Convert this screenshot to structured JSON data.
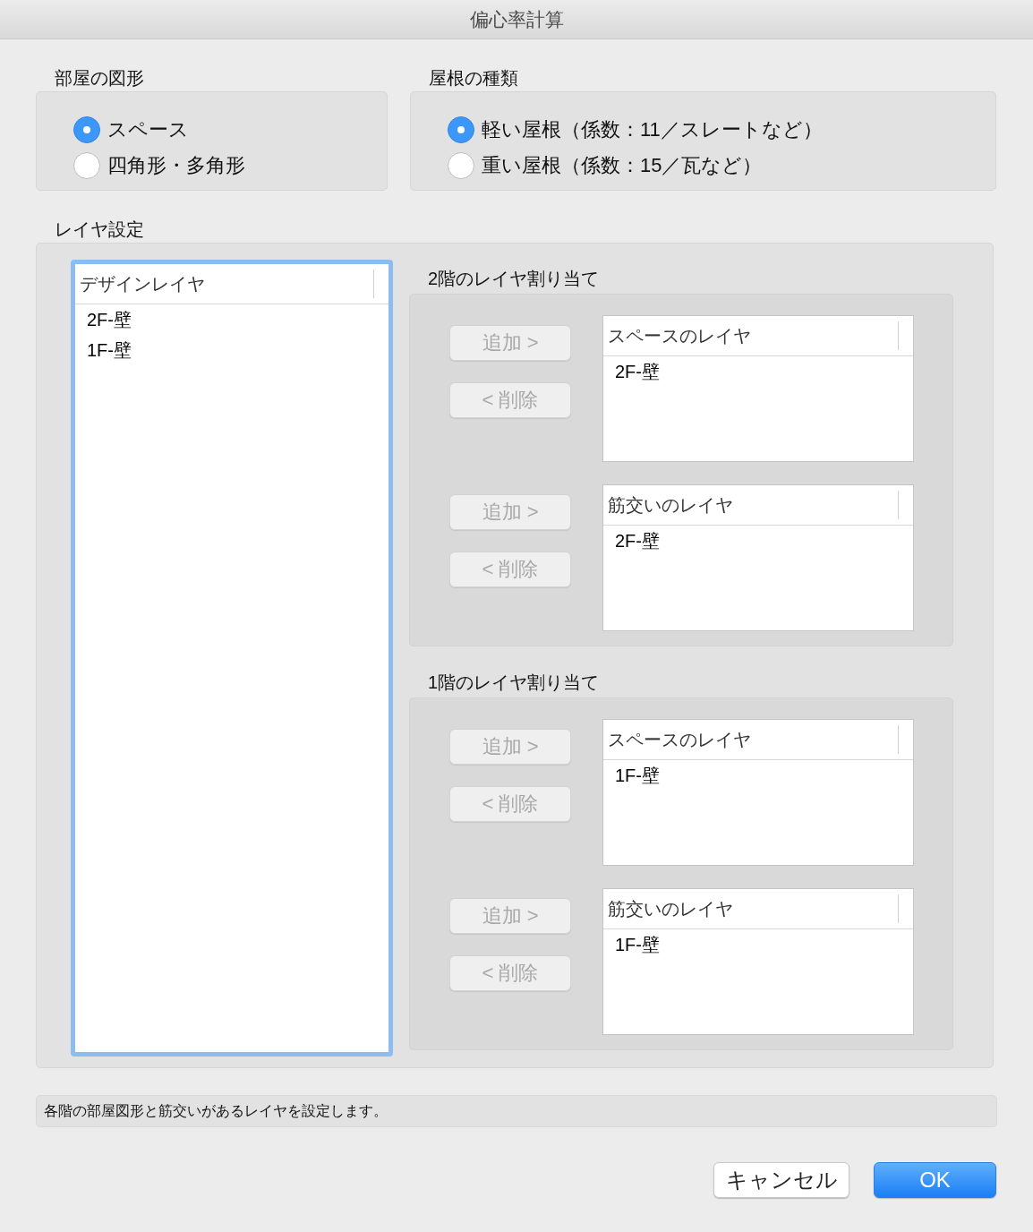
{
  "window": {
    "title": "偏心率計算"
  },
  "room_shape": {
    "label": "部屋の図形",
    "options": [
      {
        "label": "スペース",
        "selected": true
      },
      {
        "label": "四角形・多角形",
        "selected": false
      }
    ]
  },
  "roof_type": {
    "label": "屋根の種類",
    "options": [
      {
        "label": "軽い屋根（係数：11／スレートなど）",
        "selected": true
      },
      {
        "label": "重い屋根（係数：15／瓦など）",
        "selected": false
      }
    ]
  },
  "layer_settings": {
    "label": "レイヤ設定",
    "design_layers": {
      "header": "デザインレイヤ",
      "focused": true,
      "items": [
        "2F-壁",
        "1F-壁"
      ]
    },
    "floors": [
      {
        "label": "2階のレイヤ割り当て",
        "assignments": [
          {
            "add_button": {
              "label": "追加 >",
              "disabled": true
            },
            "remove_button": {
              "label": "< 削除",
              "disabled": true
            },
            "list": {
              "header": "スペースのレイヤ",
              "items": [
                "2F-壁"
              ]
            }
          },
          {
            "add_button": {
              "label": "追加 >",
              "disabled": true
            },
            "remove_button": {
              "label": "< 削除",
              "disabled": true
            },
            "list": {
              "header": "筋交いのレイヤ",
              "items": [
                "2F-壁"
              ]
            }
          }
        ]
      },
      {
        "label": "1階のレイヤ割り当て",
        "assignments": [
          {
            "add_button": {
              "label": "追加 >",
              "disabled": true
            },
            "remove_button": {
              "label": "< 削除",
              "disabled": true
            },
            "list": {
              "header": "スペースのレイヤ",
              "items": [
                "1F-壁"
              ]
            }
          },
          {
            "add_button": {
              "label": "追加 >",
              "disabled": true
            },
            "remove_button": {
              "label": "< 削除",
              "disabled": true
            },
            "list": {
              "header": "筋交いのレイヤ",
              "items": [
                "1F-壁"
              ]
            }
          }
        ]
      }
    ]
  },
  "status_text": "各階の部屋図形と筋交いがあるレイヤを設定します。",
  "buttons": [
    {
      "label": "キャンセル",
      "kind": "default"
    },
    {
      "label": "OK",
      "kind": "primary"
    }
  ]
}
